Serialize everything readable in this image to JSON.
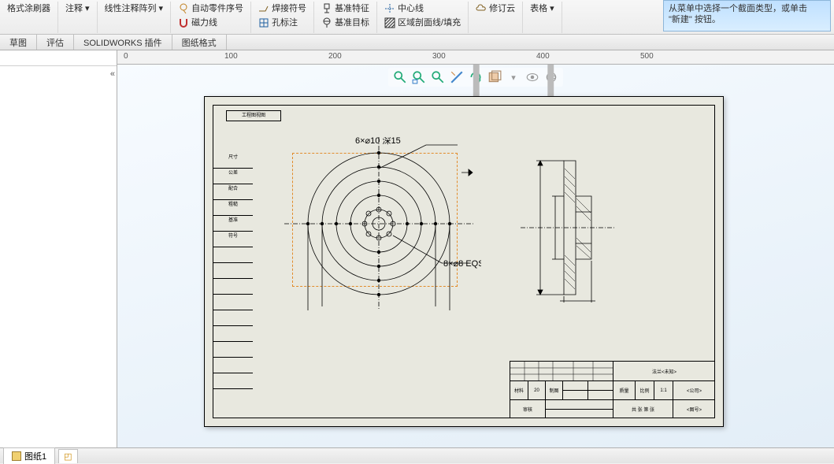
{
  "ribbon": {
    "group1a": "格式涂刷器",
    "group1b": "注释",
    "group1c": "线性注释阵列",
    "autoPartNum": "自动零件序号",
    "magLine": "磁力线",
    "weldSym": "焊接符号",
    "holeCall": "孔标注",
    "datumFeat": "基准特征",
    "datumTgt": "基准目标",
    "centerline": "中心线",
    "areaHatch": "区域剖面线/填充",
    "revCloud": "修订云",
    "tablesLbl": "表格"
  },
  "tabs": {
    "t1": "草图",
    "t2": "评估",
    "t3": "SOLIDWORKS 插件",
    "t4": "图纸格式"
  },
  "ruler": {
    "r0": "0",
    "r100": "100",
    "r200": "200",
    "r300": "300",
    "r400": "400",
    "r500": "500"
  },
  "inspector": {
    "line1": "从菜单中选择一个截面类型，或单击",
    "line2": "\"新建\" 按钮。"
  },
  "bottom": {
    "sheet1": "图纸1"
  },
  "titleblock": {
    "partName": "法兰<未知>",
    "matLabel": "材料",
    "matVal": "20",
    "procLabel": "制图",
    "scaleLabel": "比例",
    "scaleVal": "1:1",
    "massLabel": "质量",
    "checkLabel": "审核",
    "rev": "共 张 第 张",
    "co": "<公司>",
    "dwgNo": "<图号>"
  },
  "leftcol": {
    "a": "尺寸",
    "b": "公差",
    "c": "配合",
    "d": "粗糙",
    "e": "基准",
    "f": "符号"
  },
  "floatbar": {
    "zoomArea": "zoom-area",
    "zoomFit": "zoom-fit",
    "zoomPrev": "zoom-prev",
    "sectView": "section-view",
    "redo": "redo",
    "props": "properties",
    "display": "display-style",
    "hide": "hide-show",
    "opts": "view-options"
  },
  "toptag": "工程图视图"
}
